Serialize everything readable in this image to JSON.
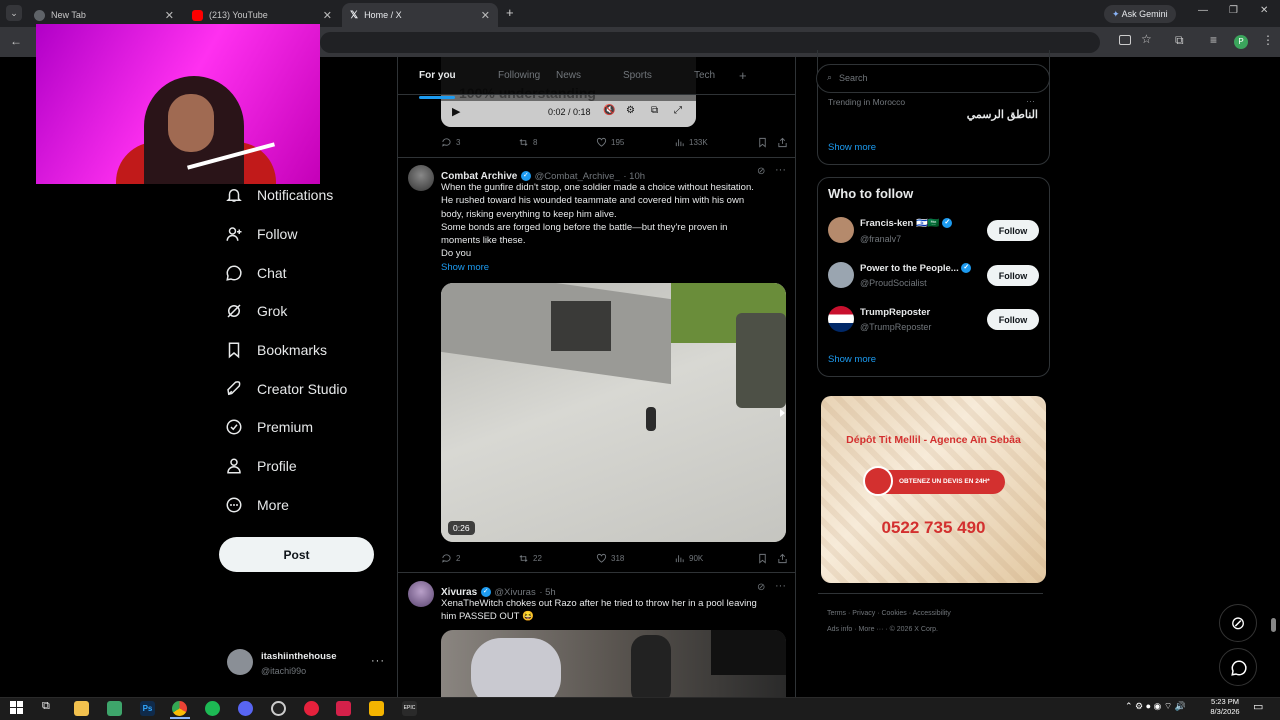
{
  "browser": {
    "tabs": [
      {
        "title": "New Tab",
        "fav_color": "#5f6368"
      },
      {
        "title": "(213) YouTube",
        "fav_color": "#ff0000"
      },
      {
        "title": "Home / X",
        "fav_color": "#000000"
      }
    ],
    "ask_gemini": "Ask Gemini",
    "profile_initial": "P"
  },
  "nav": {
    "items": [
      "Notifications",
      "Follow",
      "Chat",
      "Grok",
      "Bookmarks",
      "Creator Studio",
      "Premium",
      "Profile",
      "More"
    ],
    "post_label": "Post",
    "account_name": "itashiinthehouse",
    "account_handle": "@itachi99o"
  },
  "timeline": {
    "tabs": [
      "For you",
      "Following",
      "News",
      "Sports",
      "Tech"
    ],
    "video_time": "0:02 / 0:18",
    "video_caption": "100% understanding",
    "top_actions": {
      "replies": "3",
      "reposts": "8",
      "likes": "195",
      "views": "133K"
    },
    "tweet1": {
      "name": "Combat Archive",
      "handle": "@Combat_Archive_",
      "time": "· 10h",
      "lines": [
        "When the gunfire didn't stop, one soldier made a choice without hesitation.",
        "He rushed toward his wounded teammate and covered him with his own",
        "body, risking everything to keep him alive.",
        "Some bonds are forged long before the battle—but they're proven in",
        "moments like these.",
        "Do you"
      ],
      "show_more": "Show more",
      "duration": "0:26",
      "actions": {
        "replies": "2",
        "reposts": "22",
        "likes": "318",
        "views": "90K"
      }
    },
    "tweet2": {
      "name": "Xivuras",
      "handle": "@Xivuras",
      "time": "· 5h",
      "lines": [
        "XenaTheWitch chokes out Razo after he tried to throw her in a pool leaving",
        "him PASSED OUT 😆"
      ]
    }
  },
  "right": {
    "search_placeholder": "Search",
    "trending_context": "Trending in Morocco",
    "trending_topic": "الناطق الرسمي",
    "show_more": "Show more",
    "who_to_follow": "Who to follow",
    "follow_label": "Follow",
    "suggestions": [
      {
        "name": "Francis-ken 🇮🇱🇸🇦",
        "handle": "@franalv7"
      },
      {
        "name": "Power to the People...",
        "handle": "@ProudSocialist"
      },
      {
        "name": "TrumpReposter",
        "handle": "@TrumpReposter"
      }
    ],
    "ad": {
      "title": "Dépôt Tit Mellil - Agence Aïn Sebâa",
      "cta": "OBTENEZ UN DEVIS EN 24H*",
      "phone": "0522 735 490"
    },
    "footer": [
      "Terms",
      "Privacy",
      "Cookies",
      "Accessibility",
      "Ads info",
      "More ···",
      "© 2026 X Corp."
    ]
  },
  "taskbar": {
    "time": "5:23 PM",
    "date": "8/3/2026"
  }
}
